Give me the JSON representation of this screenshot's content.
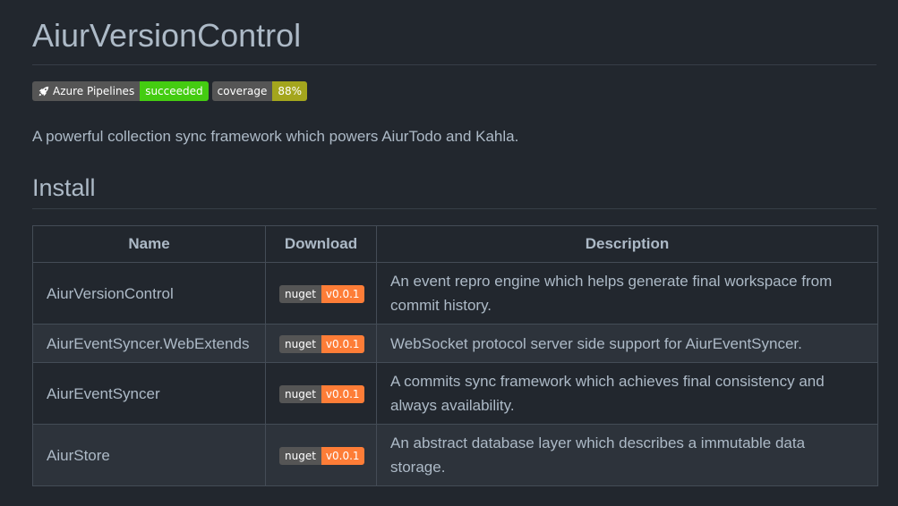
{
  "title": "AiurVersionControl",
  "badges": {
    "azure": {
      "icon": "rocket-icon",
      "label": "Azure Pipelines",
      "status": "succeeded",
      "status_color": "#44cc11"
    },
    "coverage": {
      "label": "coverage",
      "value": "88%",
      "value_color": "#a4a61d"
    }
  },
  "description": "A powerful collection sync framework which powers AiurTodo and Kahla.",
  "install_heading": "Install",
  "table": {
    "headers": {
      "name": "Name",
      "download": "Download",
      "description": "Description"
    },
    "rows": [
      {
        "name": "AiurVersionControl",
        "badge_label": "nuget",
        "badge_version": "v0.0.1",
        "description": "An event repro engine which helps generate final workspace from commit history."
      },
      {
        "name": "AiurEventSyncer.WebExtends",
        "badge_label": "nuget",
        "badge_version": "v0.0.1",
        "description": "WebSocket protocol server side support for AiurEventSyncer."
      },
      {
        "name": "AiurEventSyncer",
        "badge_label": "nuget",
        "badge_version": "v0.0.1",
        "description": "A commits sync framework which achieves final consistency and always availability."
      },
      {
        "name": "AiurStore",
        "badge_label": "nuget",
        "badge_version": "v0.0.1",
        "description": "An abstract database layer which describes a immutable data storage."
      }
    ]
  },
  "colors": {
    "background": "#22272e",
    "text": "#adbac7",
    "nuget_version": "#fe7d37"
  }
}
